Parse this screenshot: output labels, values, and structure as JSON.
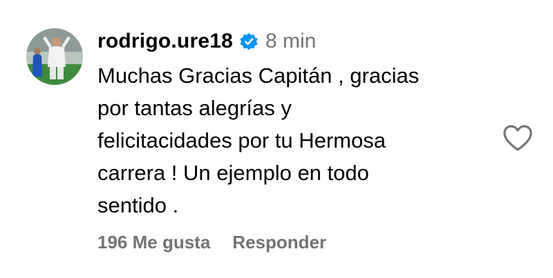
{
  "comment": {
    "username": "rodrigo.ure18",
    "verified_icon": "verified-badge-icon",
    "timestamp": "8 min",
    "text": "Muchas Gracias Capitán , gracias\npor tantas alegrías y\nfelicitacidades por tu Hermosa\ncarrera ! Un ejemplo en todo\nsentido .",
    "likes_label": "196 Me gusta",
    "reply_label": "Responder",
    "like_icon": "heart-outline-icon"
  },
  "colors": {
    "verified_blue": "#0095f6",
    "secondary_text": "#737373",
    "primary_text": "#000000"
  }
}
